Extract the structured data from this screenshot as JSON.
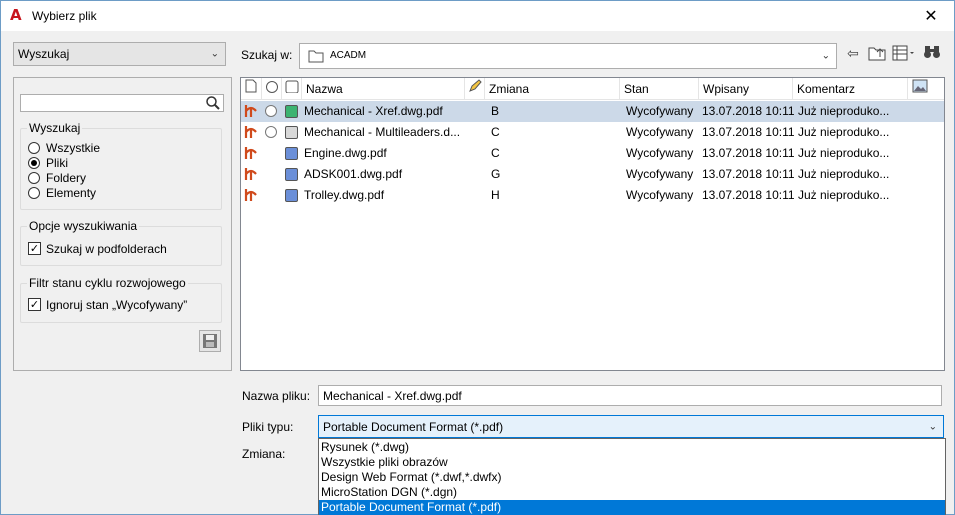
{
  "window": {
    "title": "Wybierz plik",
    "app_icon": "autocad-a-icon",
    "close_glyph": "✕"
  },
  "left": {
    "mode_select": {
      "value": "Wyszukaj"
    },
    "search": {
      "placeholder": ""
    },
    "scope_group": {
      "title": "Wyszukaj",
      "options": [
        "Wszystkie",
        "Pliki",
        "Foldery",
        "Elementy"
      ],
      "selected_index": 1
    },
    "search_options": {
      "title": "Opcje wyszukiwania",
      "subfolders_label": "Szukaj w podfolderach",
      "subfolders_checked": true
    },
    "lifecycle": {
      "title": "Filtr stanu cyklu rozwojowego",
      "ignore_label": "Ignoruj stan „Wycofywany”",
      "ignore_checked": true
    },
    "save_icon": "save-icon"
  },
  "lookin": {
    "label": "Szukaj w:",
    "value": "ACADM"
  },
  "toolbar": {
    "icons": [
      "back-arrow-icon",
      "up-folder-icon",
      "view-menu-icon",
      "binoculars-icon"
    ]
  },
  "table": {
    "columns": [
      "Nazwa",
      "Zmiana",
      "Stan",
      "Wpisany",
      "Komentarz"
    ],
    "rows": [
      {
        "name": "Mechanical - Xref.dwg.pdf",
        "rev": "B",
        "state": "Wycofywany",
        "date": "13.07.2018 10:11",
        "comment": "Już nieproduko...",
        "status_color": "#3cb371",
        "ring": true,
        "selected": true
      },
      {
        "name": "Mechanical - Multileaders.d...",
        "rev": "C",
        "state": "Wycofywany",
        "date": "13.07.2018 10:11",
        "comment": "Już nieproduko...",
        "status_color": "#d8d8d8",
        "ring": true,
        "selected": false
      },
      {
        "name": "Engine.dwg.pdf",
        "rev": "C",
        "state": "Wycofywany",
        "date": "13.07.2018 10:11",
        "comment": "Już nieproduko...",
        "status_color": "#6b8fd8",
        "ring": false,
        "selected": false
      },
      {
        "name": "ADSK001.dwg.pdf",
        "rev": "G",
        "state": "Wycofywany",
        "date": "13.07.2018 10:11",
        "comment": "Już nieproduko...",
        "status_color": "#6b8fd8",
        "ring": false,
        "selected": false
      },
      {
        "name": "Trolley.dwg.pdf",
        "rev": "H",
        "state": "Wycofywany",
        "date": "13.07.2018 10:11",
        "comment": "Już nieproduko...",
        "status_color": "#6b8fd8",
        "ring": false,
        "selected": false
      }
    ]
  },
  "filename": {
    "label": "Nazwa pliku:",
    "value": "Mechanical - Xref.dwg.pdf"
  },
  "filetype": {
    "label": "Pliki typu:",
    "value": "Portable Document Format (*.pdf)",
    "options": [
      "Rysunek (*.dwg)",
      "Wszystkie pliki obrazów",
      "Design Web Format (*.dwf,*.dwfx)",
      "MicroStation DGN (*.dgn)",
      "Portable Document Format (*.pdf)"
    ],
    "selected_index": 4
  },
  "revision": {
    "label": "Zmiana:"
  },
  "colors": {
    "accent": "#0078d7",
    "selected_row": "#ccd9e8"
  }
}
